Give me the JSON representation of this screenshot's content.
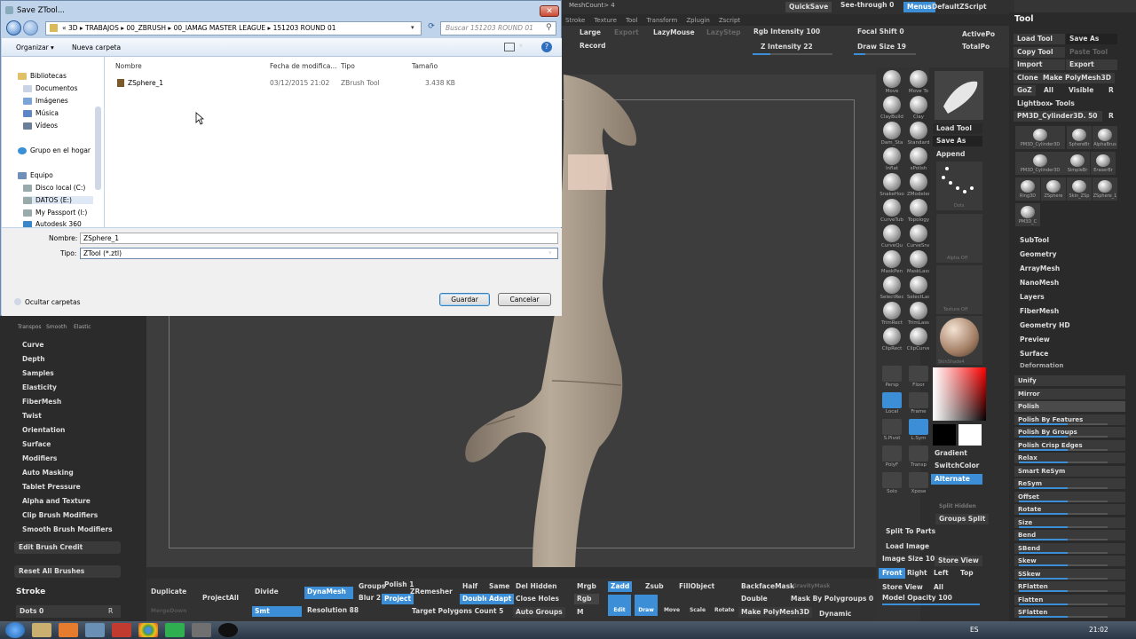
{
  "dialog": {
    "title": "Save ZTool...",
    "close": "✕",
    "breadcrumb": "«  3D  ▸  TRABAJOS  ▸  00_ZBRUSH  ▸  00_IAMAG MASTER LEAGUE  ▸  151203 ROUND 01",
    "search_placeholder": "Buscar 151203 ROUND 01",
    "organize": "Organizar ▾",
    "new_folder": "Nueva carpeta",
    "nav": {
      "libraries": "Bibliotecas",
      "documents": "Documentos",
      "images": "Imágenes",
      "music": "Música",
      "videos": "Vídeos",
      "homegroup": "Grupo en el hogar",
      "computer": "Equipo",
      "disk_c": "Disco local (C:)",
      "disk_e": "DATOS (E:)",
      "passport": "My Passport (I:)",
      "autodesk": "Autodesk 360"
    },
    "columns": {
      "name": "Nombre",
      "date": "Fecha de modifica...",
      "type": "Tipo",
      "size": "Tamaño"
    },
    "file": {
      "name": "ZSphere_1",
      "date": "03/12/2015 21:02",
      "type": "ZBrush Tool",
      "size": "3.438 KB"
    },
    "name_label": "Nombre:",
    "name_value": "ZSphere_1",
    "type_label": "Tipo:",
    "type_value": "ZTool (*.ztl)",
    "hide_folders": "Ocultar carpetas",
    "save": "Guardar",
    "cancel": "Cancelar"
  },
  "zbrush": {
    "top": {
      "quicksave": "QuickSave",
      "seethrough": "See-through  0",
      "menus": "Menus",
      "defaultzscript": "DefaultZScript",
      "large": "Large",
      "export": "Export",
      "record": "Record",
      "lazymouse": "LazyMouse",
      "lazystep": "LazyStep",
      "rgb_intensity": "Rgb Intensity 100",
      "z_intensity": "Z Intensity 22",
      "focal_shift": "Focal Shift 0",
      "draw_size": "Draw Size 19",
      "activepoints": "ActivePo",
      "totalpoints": "TotalPo",
      "menu": [
        "Stroke",
        "Texture",
        "Tool",
        "Transform",
        "Zplugin",
        "Zscript"
      ],
      "meshcount": "MeshCount> 4"
    },
    "left": {
      "icons": [
        "Transpos",
        "Smooth",
        "Elastic"
      ],
      "items": [
        "Curve",
        "Depth",
        "Samples",
        "Elasticity",
        "FiberMesh",
        "Twist",
        "Orientation",
        "Surface",
        "Modifiers",
        "Auto Masking",
        "Tablet Pressure",
        "Alpha and Texture",
        "Clip Brush Modifiers",
        "Smooth Brush Modifiers"
      ],
      "edit_credit": "Edit Brush Credit",
      "reset": "Reset All Brushes",
      "stroke": "Stroke",
      "dots": "Dots 0",
      "r": "R"
    },
    "shelf": [
      "Move",
      "Move To",
      "ClayBuild",
      "Clay",
      "Dam_Sta",
      "Standard",
      "Inflat",
      "sPolish",
      "SnakeHoo",
      "ZModeler",
      "CurveTub",
      "Topology",
      "CurveQu",
      "CurveSna",
      "MaskPen",
      "MaskLass",
      "SelectRec",
      "SelectLas",
      "TrimRect",
      "TrimLass",
      "ClipRect",
      "ClipCurve"
    ],
    "mid": {
      "load_tool": "Load Tool",
      "save_as": "Save As",
      "append": "Append",
      "dots": "Dots",
      "alpha_off": "Alpha Off",
      "texture_off": "Texture Off",
      "matcap": "SkinShade4",
      "gradient": "Gradient",
      "switchcolor": "SwitchColor",
      "alternate": "Alternate",
      "split_hidden": "Split Hidden",
      "groups_split": "Groups Split",
      "split_to_parts": "Split To Parts",
      "load_image": "Load Image",
      "image_size": "Image Size 100",
      "store_view": "Store View",
      "front": "Front",
      "right": "Right",
      "left": "Left",
      "top": "Top",
      "store_view2": "Store View",
      "all": "All",
      "model_opacity": "Model Opacity 100",
      "side": [
        "Persp",
        "Floor",
        "Local",
        "Frame",
        "S.Pivot",
        "L.Sym",
        "PolyF",
        "Transp",
        "Solo",
        "Xpose"
      ]
    },
    "tool": {
      "title": "Tool",
      "load_tool": "Load Tool",
      "save_as": "Save As",
      "copy_tool": "Copy Tool",
      "paste_tool": "Paste Tool",
      "import": "Import",
      "export": "Export",
      "clone": "Clone",
      "make_polymesh": "Make PolyMesh3D",
      "goz": "GoZ",
      "all": "All",
      "visible": "Visible",
      "r": "R",
      "lightbox": "Lightbox▸ Tools",
      "current": "PM3D_Cylinder3D. 50",
      "thumbs": [
        "PM3D_Cylinder3D",
        "SphereBr",
        "AlphaBrus",
        "PM3D_Cylinder3D",
        "SimpleBr",
        "EraserBr",
        "Ring3D",
        "ZSphere",
        "Skin_ZSp",
        "ZSphere_1",
        "PM3D_C"
      ],
      "count": "5",
      "menu": [
        "SubTool",
        "Geometry",
        "ArrayMesh",
        "NanoMesh",
        "Layers",
        "FiberMesh",
        "Geometry HD",
        "Preview",
        "Surface",
        "Deformation"
      ],
      "deform": [
        "Unify",
        "Mirror",
        "Polish",
        "Polish By Features",
        "Polish By Groups",
        "Polish Crisp Edges",
        "Relax",
        "Smart ReSym",
        "ReSym",
        "Offset",
        "Rotate",
        "Size",
        "Bend",
        "SBend",
        "Skew",
        "SSkew",
        "RFlatten",
        "Flatten",
        "SFlatten"
      ]
    },
    "bottom": {
      "duplicate": "Duplicate",
      "mergedown": "MergeDown",
      "projectall": "ProjectAll",
      "divide": "Divide",
      "smt": "Smt",
      "dynamesh": "DynaMesh",
      "groups": "Groups",
      "polish": "Polish 1",
      "blur": "Blur 2",
      "project": "Project",
      "resolution": "Resolution 88",
      "zremesher": "ZRemesher",
      "target": "Target Polygons Count 5",
      "half": "Half",
      "same": "Same",
      "double": "Double",
      "adapt": "Adapt",
      "del_hidden": "Del Hidden",
      "close_holes": "Close Holes",
      "auto_groups": "Auto Groups",
      "mrgb": "Mrgb",
      "rgb": "Rgb",
      "m": "M",
      "zadd": "Zadd",
      "zsub": "Zsub",
      "fillobject": "FillObject",
      "edit": "Edit",
      "draw": "Draw",
      "move": "Move",
      "scale": "Scale",
      "rotate": "Rotate",
      "backfacemask": "BackfaceMask",
      "double2": "Double",
      "mask_by_poly": "Mask By Polygroups 0",
      "make_polymesh": "Make PolyMesh3D",
      "dynamic": "Dynamic",
      "gravity": "GravityMask"
    }
  },
  "taskbar": {
    "lang": "ES",
    "time": "21:02"
  }
}
